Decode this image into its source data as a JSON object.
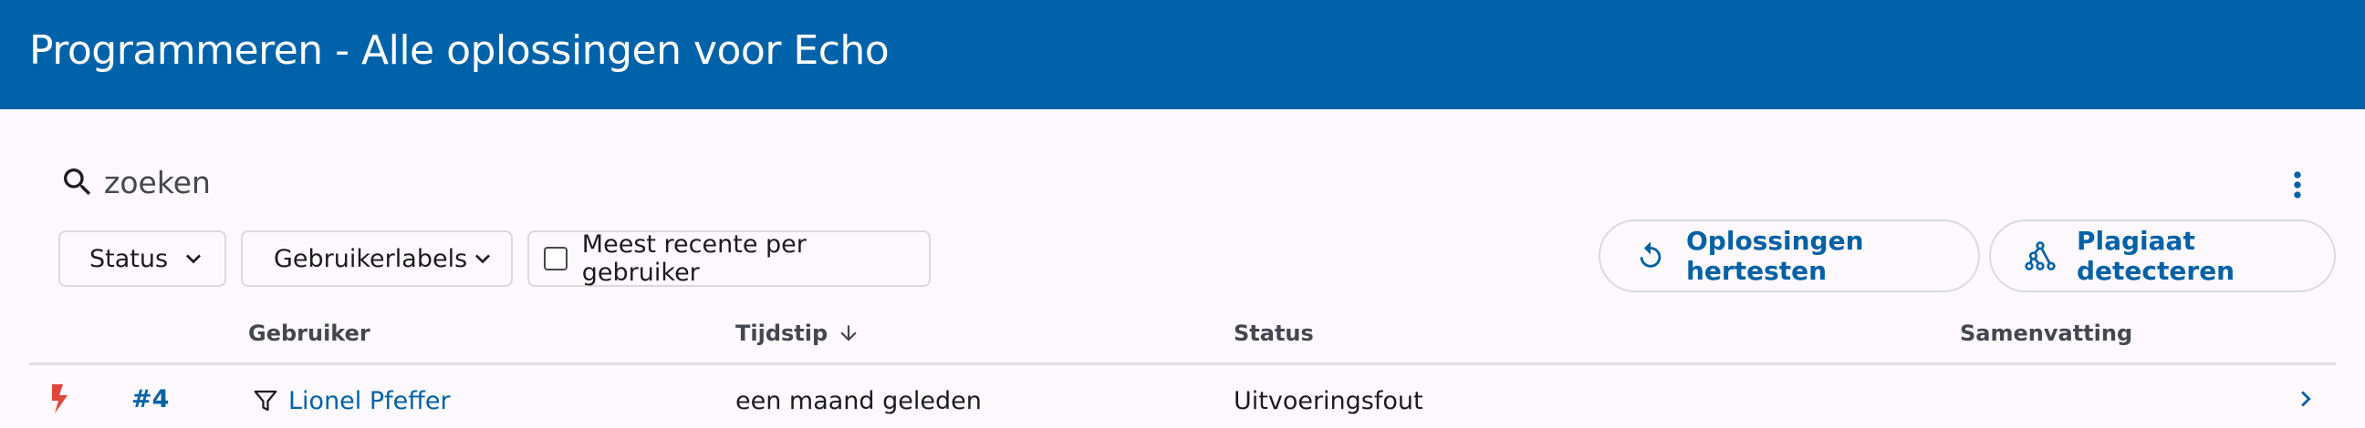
{
  "header": {
    "title": "Programmeren - Alle oplossingen voor Echo"
  },
  "search": {
    "placeholder": "zoeken",
    "value": ""
  },
  "filters": {
    "status_label": "Status",
    "user_labels_label": "Gebruikerlabels",
    "most_recent_label": "Meest recente per gebruiker",
    "most_recent_checked": false
  },
  "actions": {
    "retest_label": "Oplossingen hertesten",
    "plagiarism_label": "Plagiaat detecteren"
  },
  "table": {
    "columns": {
      "user": "Gebruiker",
      "time": "Tijdstip",
      "status": "Status",
      "summary": "Samenvatting"
    },
    "sort": {
      "column": "time",
      "direction": "descending"
    },
    "rows": [
      {
        "status_icon": "bolt-icon",
        "id": "#4",
        "user": "Lionel Pfeffer",
        "time": "een maand geleden",
        "status": "Uitvoeringsfout",
        "summary": ""
      }
    ]
  },
  "colors": {
    "header_bg": "#0062a8",
    "accent": "#0061a4",
    "error": "#e2453b",
    "background": "#fdf8fc"
  }
}
